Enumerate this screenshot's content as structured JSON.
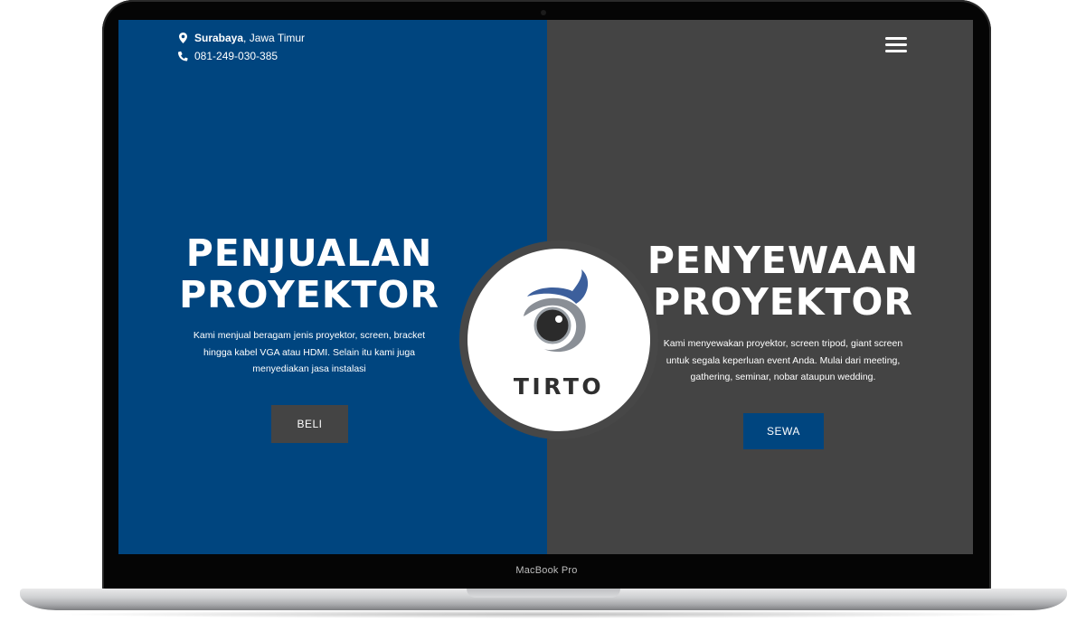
{
  "device": {
    "model_label": "MacBook Pro"
  },
  "colors": {
    "primary_blue": "#00457f",
    "dark_gray": "#444444",
    "white": "#ffffff"
  },
  "header": {
    "location_city": "Surabaya",
    "location_region": ", Jawa Timur",
    "phone": "081-249-030-385",
    "location_icon": "map-pin-icon",
    "phone_icon": "phone-icon",
    "menu_icon": "hamburger-menu-icon"
  },
  "logo": {
    "text": "TIRTO",
    "icon": "eye-logo-icon"
  },
  "sales": {
    "title_line1": "PENJUALAN",
    "title_line2": "PROYEKTOR",
    "desc_line1": "Kami menjual beragam jenis proyektor, screen, bracket",
    "desc_line2": "hingga kabel VGA atau HDMI. Selain itu kami juga",
    "desc_line3": "menyediakan jasa instalasi",
    "button_label": "BELI"
  },
  "rental": {
    "title_line1": "PENYEWAAN",
    "title_line2": "PROYEKTOR",
    "desc_line1": "Kami menyewakan proyektor, screen tripod, giant screen",
    "desc_line2": "untuk segala keperluan event Anda. Mulai dari meeting,",
    "desc_line3": "gathering, seminar, nobar ataupun wedding.",
    "button_label": "SEWA"
  }
}
